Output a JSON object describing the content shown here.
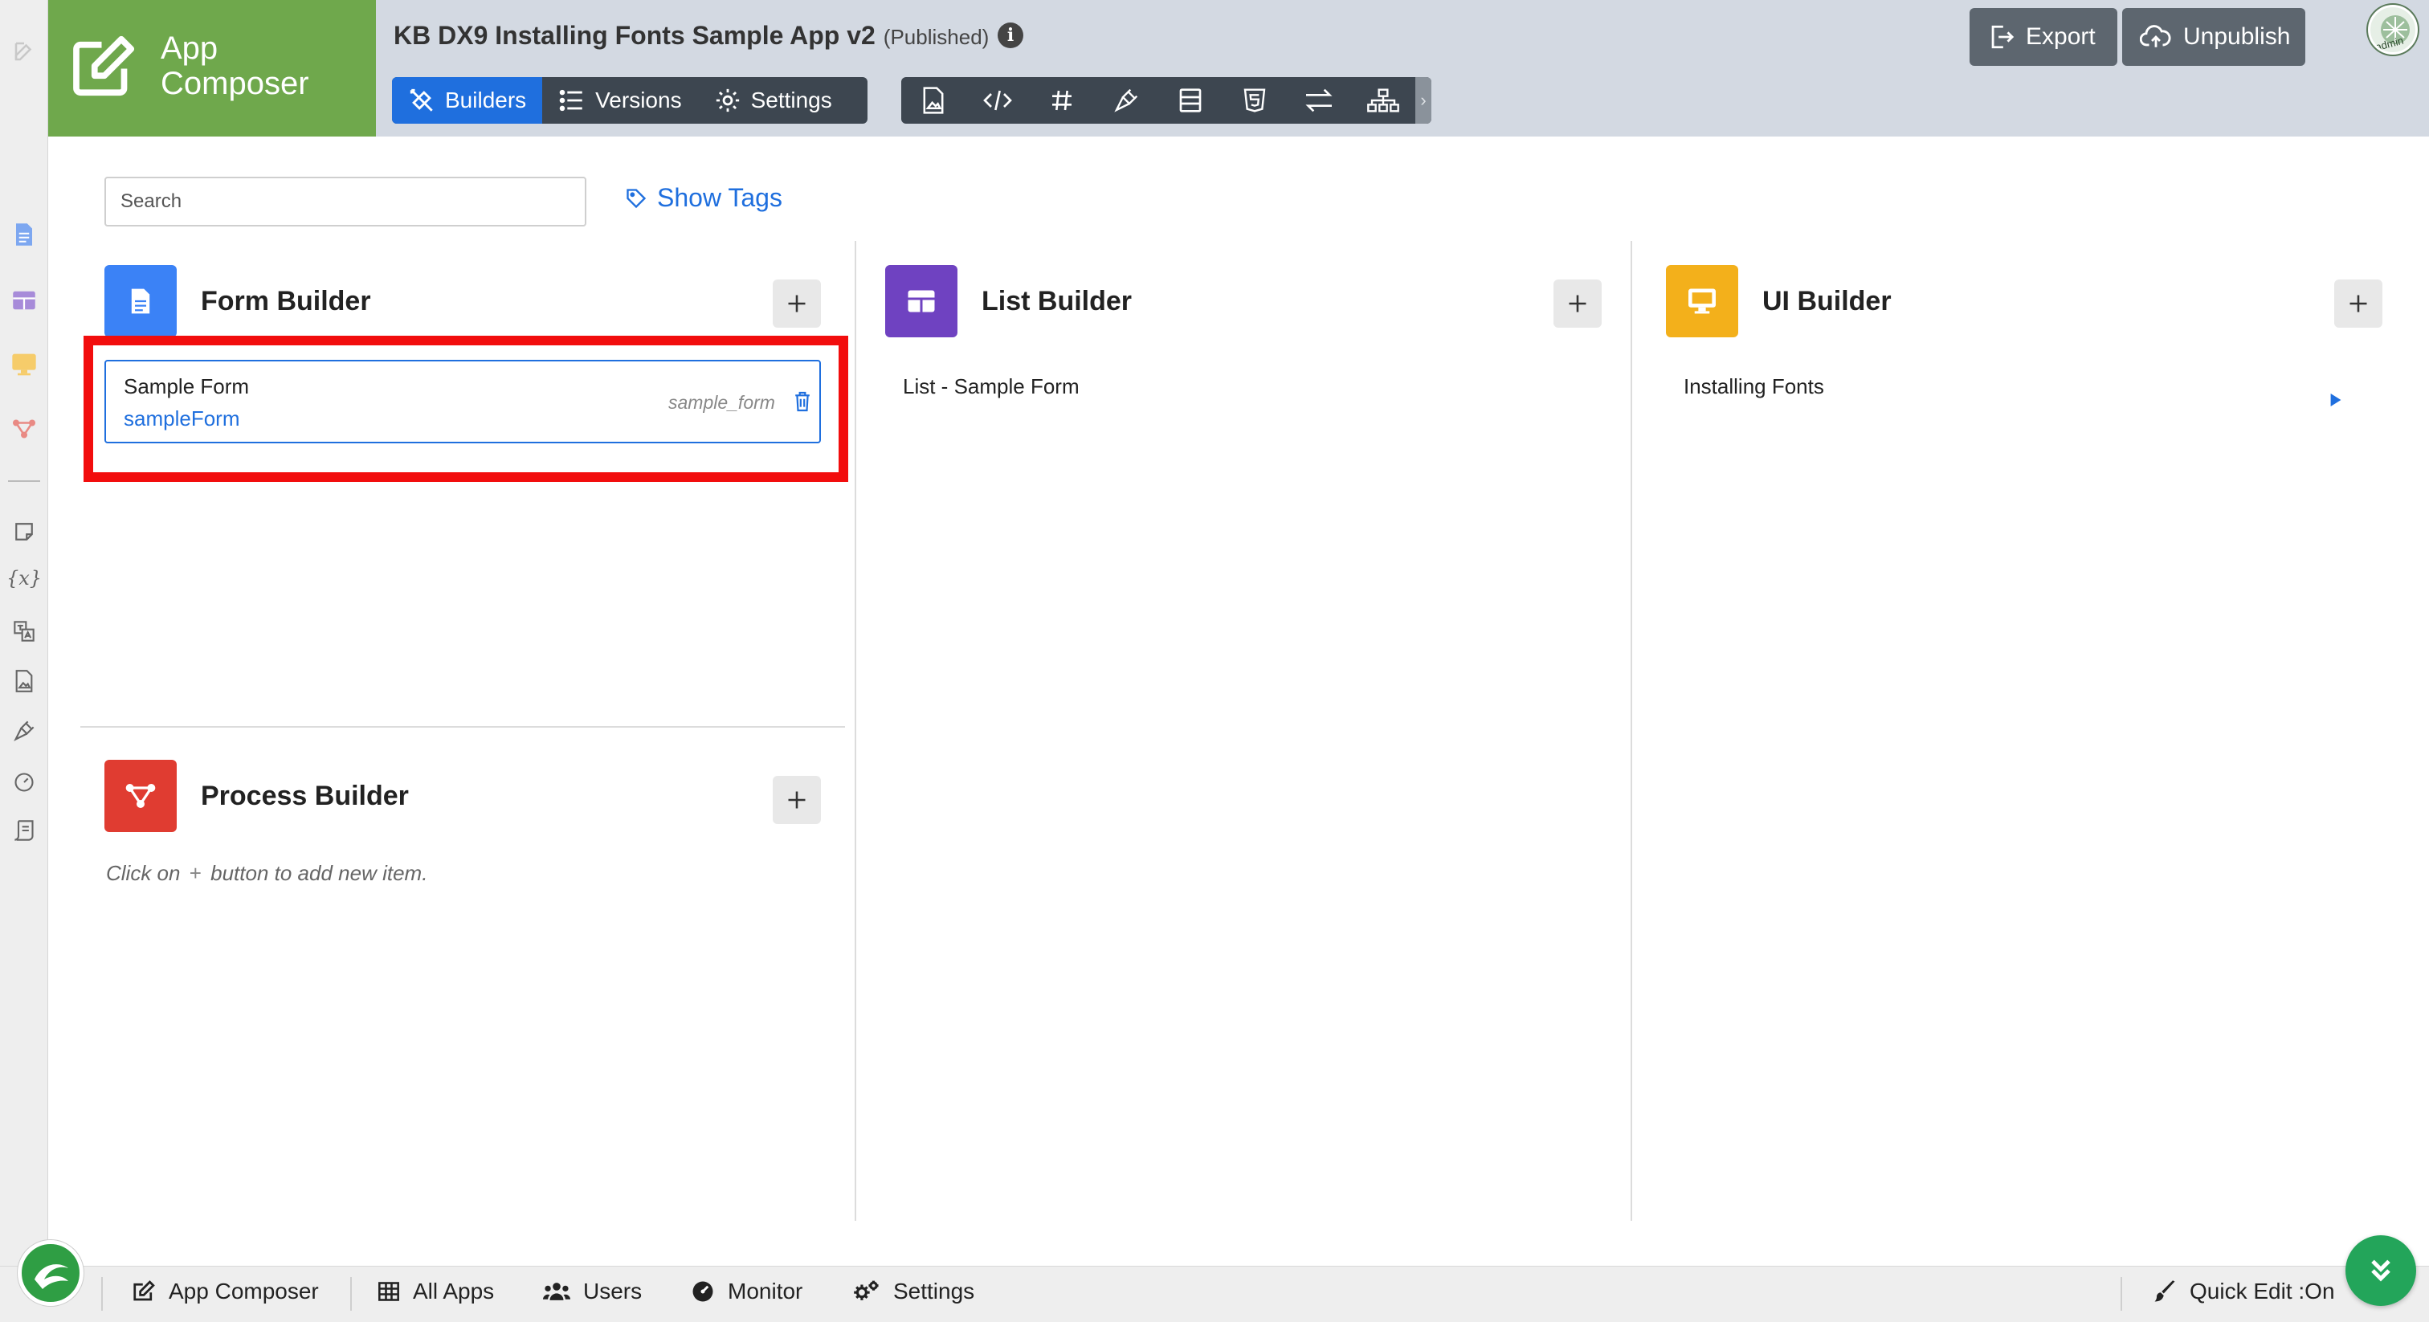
{
  "brand": {
    "line1": "App",
    "line2": "Composer"
  },
  "header": {
    "app_title": "KB DX9 Installing Fonts Sample App v2",
    "app_status": "(Published)",
    "tabs": [
      {
        "label": "Builders",
        "icon": "tools-icon",
        "active": true
      },
      {
        "label": "Versions",
        "icon": "list-icon",
        "active": false
      },
      {
        "label": "Settings",
        "icon": "gear-icon",
        "active": false
      }
    ],
    "toolbar_icons": [
      "file-image-icon",
      "code-icon",
      "hash-icon",
      "plug-icon",
      "form-icon",
      "html5-icon",
      "arrows-swap-icon",
      "sitemap-icon"
    ],
    "export_label": "Export",
    "unpublish_label": "Unpublish",
    "avatar_label": "admin"
  },
  "search": {
    "placeholder": "Search"
  },
  "show_tags_label": "Show Tags",
  "builders": {
    "form": {
      "title": "Form Builder",
      "color": "#3b82f6",
      "items": [
        {
          "name": "Sample Form",
          "id": "sampleForm",
          "table": "sample_form"
        }
      ]
    },
    "list": {
      "title": "List Builder",
      "color": "#6f42c1",
      "items": [
        {
          "name": "List - Sample Form"
        }
      ]
    },
    "ui": {
      "title": "UI Builder",
      "color": "#f3b01b",
      "items": [
        {
          "name": "Installing Fonts"
        }
      ]
    },
    "process": {
      "title": "Process Builder",
      "color": "#e03c31",
      "empty_hint_prefix": "Click on",
      "empty_hint_suffix": "button to add new item."
    }
  },
  "footer": {
    "items": [
      {
        "label": "App Composer",
        "icon": "edit-icon"
      },
      {
        "label": "All Apps",
        "icon": "grid-icon"
      },
      {
        "label": "Users",
        "icon": "users-icon"
      },
      {
        "label": "Monitor",
        "icon": "dashboard-icon"
      },
      {
        "label": "Settings",
        "icon": "cogs-icon"
      }
    ],
    "quick_edit_label": "Quick Edit :On"
  },
  "colors": {
    "brand_green": "#6fa84c",
    "primary_blue": "#1f6fde",
    "highlight_red": "#f20d0d",
    "header_bg": "#d3d9e2"
  }
}
